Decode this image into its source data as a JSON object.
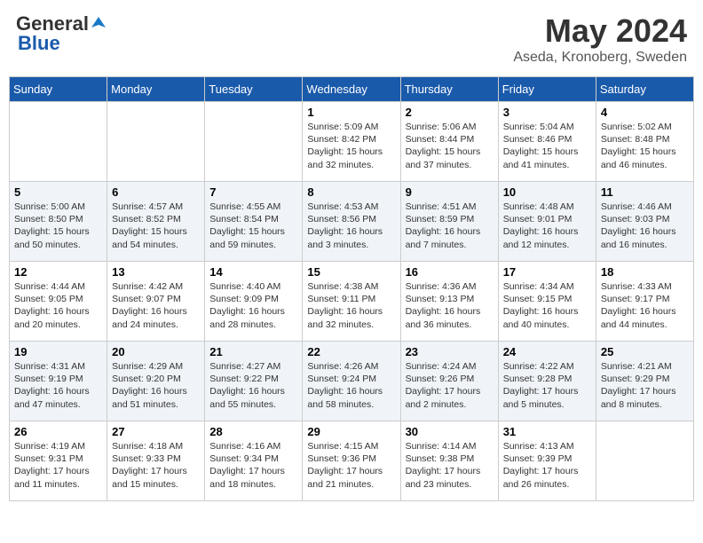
{
  "header": {
    "logo_general": "General",
    "logo_blue": "Blue",
    "month_title": "May 2024",
    "location": "Aseda, Kronoberg, Sweden"
  },
  "days_of_week": [
    "Sunday",
    "Monday",
    "Tuesday",
    "Wednesday",
    "Thursday",
    "Friday",
    "Saturday"
  ],
  "weeks": [
    [
      {
        "day": "",
        "info": ""
      },
      {
        "day": "",
        "info": ""
      },
      {
        "day": "",
        "info": ""
      },
      {
        "day": "1",
        "info": "Sunrise: 5:09 AM\nSunset: 8:42 PM\nDaylight: 15 hours\nand 32 minutes."
      },
      {
        "day": "2",
        "info": "Sunrise: 5:06 AM\nSunset: 8:44 PM\nDaylight: 15 hours\nand 37 minutes."
      },
      {
        "day": "3",
        "info": "Sunrise: 5:04 AM\nSunset: 8:46 PM\nDaylight: 15 hours\nand 41 minutes."
      },
      {
        "day": "4",
        "info": "Sunrise: 5:02 AM\nSunset: 8:48 PM\nDaylight: 15 hours\nand 46 minutes."
      }
    ],
    [
      {
        "day": "5",
        "info": "Sunrise: 5:00 AM\nSunset: 8:50 PM\nDaylight: 15 hours\nand 50 minutes."
      },
      {
        "day": "6",
        "info": "Sunrise: 4:57 AM\nSunset: 8:52 PM\nDaylight: 15 hours\nand 54 minutes."
      },
      {
        "day": "7",
        "info": "Sunrise: 4:55 AM\nSunset: 8:54 PM\nDaylight: 15 hours\nand 59 minutes."
      },
      {
        "day": "8",
        "info": "Sunrise: 4:53 AM\nSunset: 8:56 PM\nDaylight: 16 hours\nand 3 minutes."
      },
      {
        "day": "9",
        "info": "Sunrise: 4:51 AM\nSunset: 8:59 PM\nDaylight: 16 hours\nand 7 minutes."
      },
      {
        "day": "10",
        "info": "Sunrise: 4:48 AM\nSunset: 9:01 PM\nDaylight: 16 hours\nand 12 minutes."
      },
      {
        "day": "11",
        "info": "Sunrise: 4:46 AM\nSunset: 9:03 PM\nDaylight: 16 hours\nand 16 minutes."
      }
    ],
    [
      {
        "day": "12",
        "info": "Sunrise: 4:44 AM\nSunset: 9:05 PM\nDaylight: 16 hours\nand 20 minutes."
      },
      {
        "day": "13",
        "info": "Sunrise: 4:42 AM\nSunset: 9:07 PM\nDaylight: 16 hours\nand 24 minutes."
      },
      {
        "day": "14",
        "info": "Sunrise: 4:40 AM\nSunset: 9:09 PM\nDaylight: 16 hours\nand 28 minutes."
      },
      {
        "day": "15",
        "info": "Sunrise: 4:38 AM\nSunset: 9:11 PM\nDaylight: 16 hours\nand 32 minutes."
      },
      {
        "day": "16",
        "info": "Sunrise: 4:36 AM\nSunset: 9:13 PM\nDaylight: 16 hours\nand 36 minutes."
      },
      {
        "day": "17",
        "info": "Sunrise: 4:34 AM\nSunset: 9:15 PM\nDaylight: 16 hours\nand 40 minutes."
      },
      {
        "day": "18",
        "info": "Sunrise: 4:33 AM\nSunset: 9:17 PM\nDaylight: 16 hours\nand 44 minutes."
      }
    ],
    [
      {
        "day": "19",
        "info": "Sunrise: 4:31 AM\nSunset: 9:19 PM\nDaylight: 16 hours\nand 47 minutes."
      },
      {
        "day": "20",
        "info": "Sunrise: 4:29 AM\nSunset: 9:20 PM\nDaylight: 16 hours\nand 51 minutes."
      },
      {
        "day": "21",
        "info": "Sunrise: 4:27 AM\nSunset: 9:22 PM\nDaylight: 16 hours\nand 55 minutes."
      },
      {
        "day": "22",
        "info": "Sunrise: 4:26 AM\nSunset: 9:24 PM\nDaylight: 16 hours\nand 58 minutes."
      },
      {
        "day": "23",
        "info": "Sunrise: 4:24 AM\nSunset: 9:26 PM\nDaylight: 17 hours\nand 2 minutes."
      },
      {
        "day": "24",
        "info": "Sunrise: 4:22 AM\nSunset: 9:28 PM\nDaylight: 17 hours\nand 5 minutes."
      },
      {
        "day": "25",
        "info": "Sunrise: 4:21 AM\nSunset: 9:29 PM\nDaylight: 17 hours\nand 8 minutes."
      }
    ],
    [
      {
        "day": "26",
        "info": "Sunrise: 4:19 AM\nSunset: 9:31 PM\nDaylight: 17 hours\nand 11 minutes."
      },
      {
        "day": "27",
        "info": "Sunrise: 4:18 AM\nSunset: 9:33 PM\nDaylight: 17 hours\nand 15 minutes."
      },
      {
        "day": "28",
        "info": "Sunrise: 4:16 AM\nSunset: 9:34 PM\nDaylight: 17 hours\nand 18 minutes."
      },
      {
        "day": "29",
        "info": "Sunrise: 4:15 AM\nSunset: 9:36 PM\nDaylight: 17 hours\nand 21 minutes."
      },
      {
        "day": "30",
        "info": "Sunrise: 4:14 AM\nSunset: 9:38 PM\nDaylight: 17 hours\nand 23 minutes."
      },
      {
        "day": "31",
        "info": "Sunrise: 4:13 AM\nSunset: 9:39 PM\nDaylight: 17 hours\nand 26 minutes."
      },
      {
        "day": "",
        "info": ""
      }
    ]
  ]
}
